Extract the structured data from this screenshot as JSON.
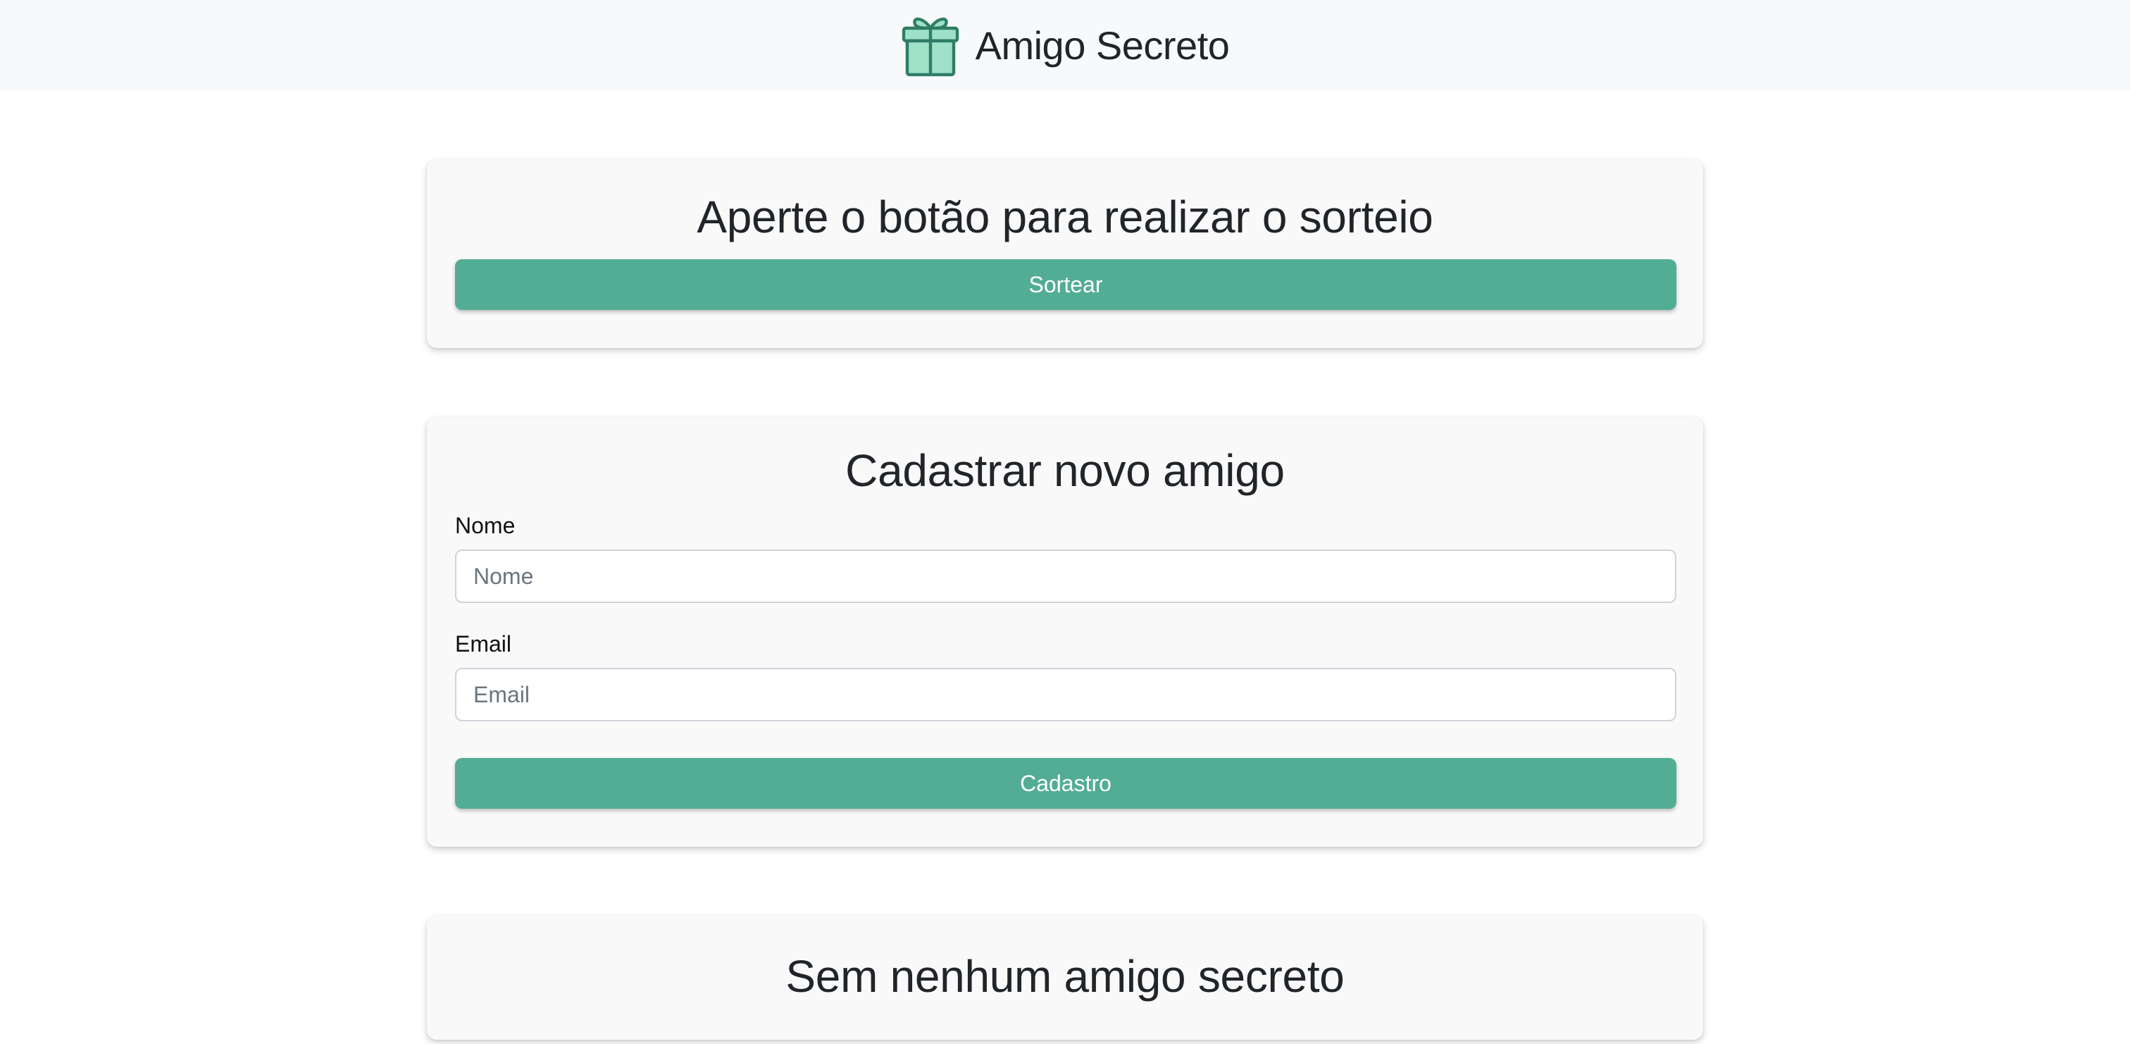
{
  "header": {
    "title": "Amigo Secreto",
    "icon": "gift-icon",
    "icon_color": "#2f7d66",
    "icon_fill": "#9fe0c8"
  },
  "draw_card": {
    "title": "Aperte o botão para realizar o sorteio",
    "button_label": "Sortear"
  },
  "register_card": {
    "title": "Cadastrar novo amigo",
    "name_label": "Nome",
    "name_placeholder": "Nome",
    "name_value": "",
    "email_label": "Email",
    "email_placeholder": "Email",
    "email_value": "",
    "button_label": "Cadastro"
  },
  "empty_card": {
    "title": "Sem nenhum amigo secreto"
  },
  "colors": {
    "accent": "#52ad94",
    "navbar_bg": "#f8f9fa",
    "card_bg": "#f9f9f9"
  }
}
